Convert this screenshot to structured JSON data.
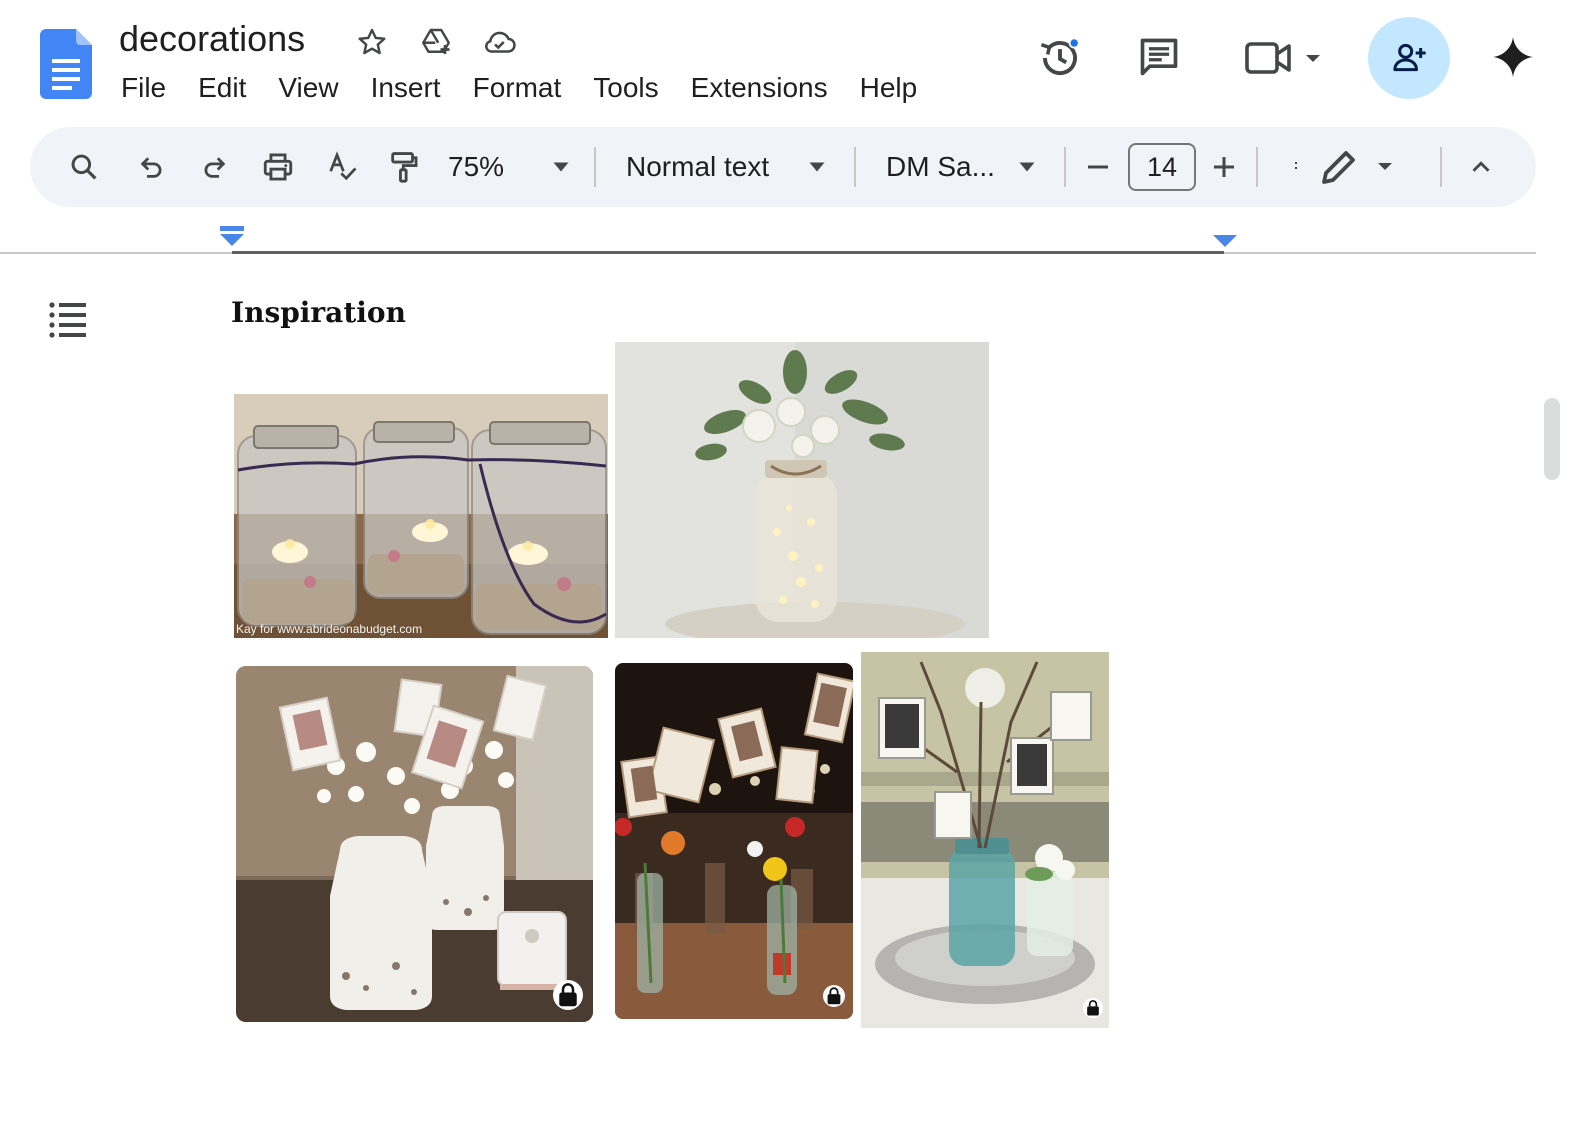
{
  "app": {
    "doc_title": "decorations",
    "menu": [
      "File",
      "Edit",
      "View",
      "Insert",
      "Format",
      "Tools",
      "Extensions",
      "Help"
    ],
    "title_icons": [
      "star-icon",
      "move-to-drive-icon",
      "cloud-saved-icon"
    ],
    "header_icons": [
      "version-history-icon",
      "comments-icon",
      "meet-camera-icon",
      "share-person-add-icon",
      "gemini-sparkle-icon"
    ],
    "accent_color": "#1a73e8",
    "share_button_color": "#c2e7ff"
  },
  "toolbar": {
    "zoom": "75%",
    "style": "Normal text",
    "font": "DM Sa...",
    "font_size": "14",
    "icons": [
      "search-icon",
      "undo-icon",
      "redo-icon",
      "print-icon",
      "spellcheck-icon",
      "paint-format-icon",
      "decrease-size-icon",
      "increase-size-icon",
      "edit-mode-pencil-icon",
      "collapse-toolbar-icon"
    ]
  },
  "document": {
    "heading": "Inspiration",
    "images": [
      {
        "name": "mason-jar-candles",
        "caption": "Kay for www.abrideonabudget.com"
      },
      {
        "name": "fairy-light-jar-flowers",
        "caption": ""
      },
      {
        "name": "white-vases-photos",
        "caption": ""
      },
      {
        "name": "bottle-vases-photos",
        "caption": ""
      },
      {
        "name": "blue-jar-branch-photos",
        "caption": ""
      }
    ]
  }
}
